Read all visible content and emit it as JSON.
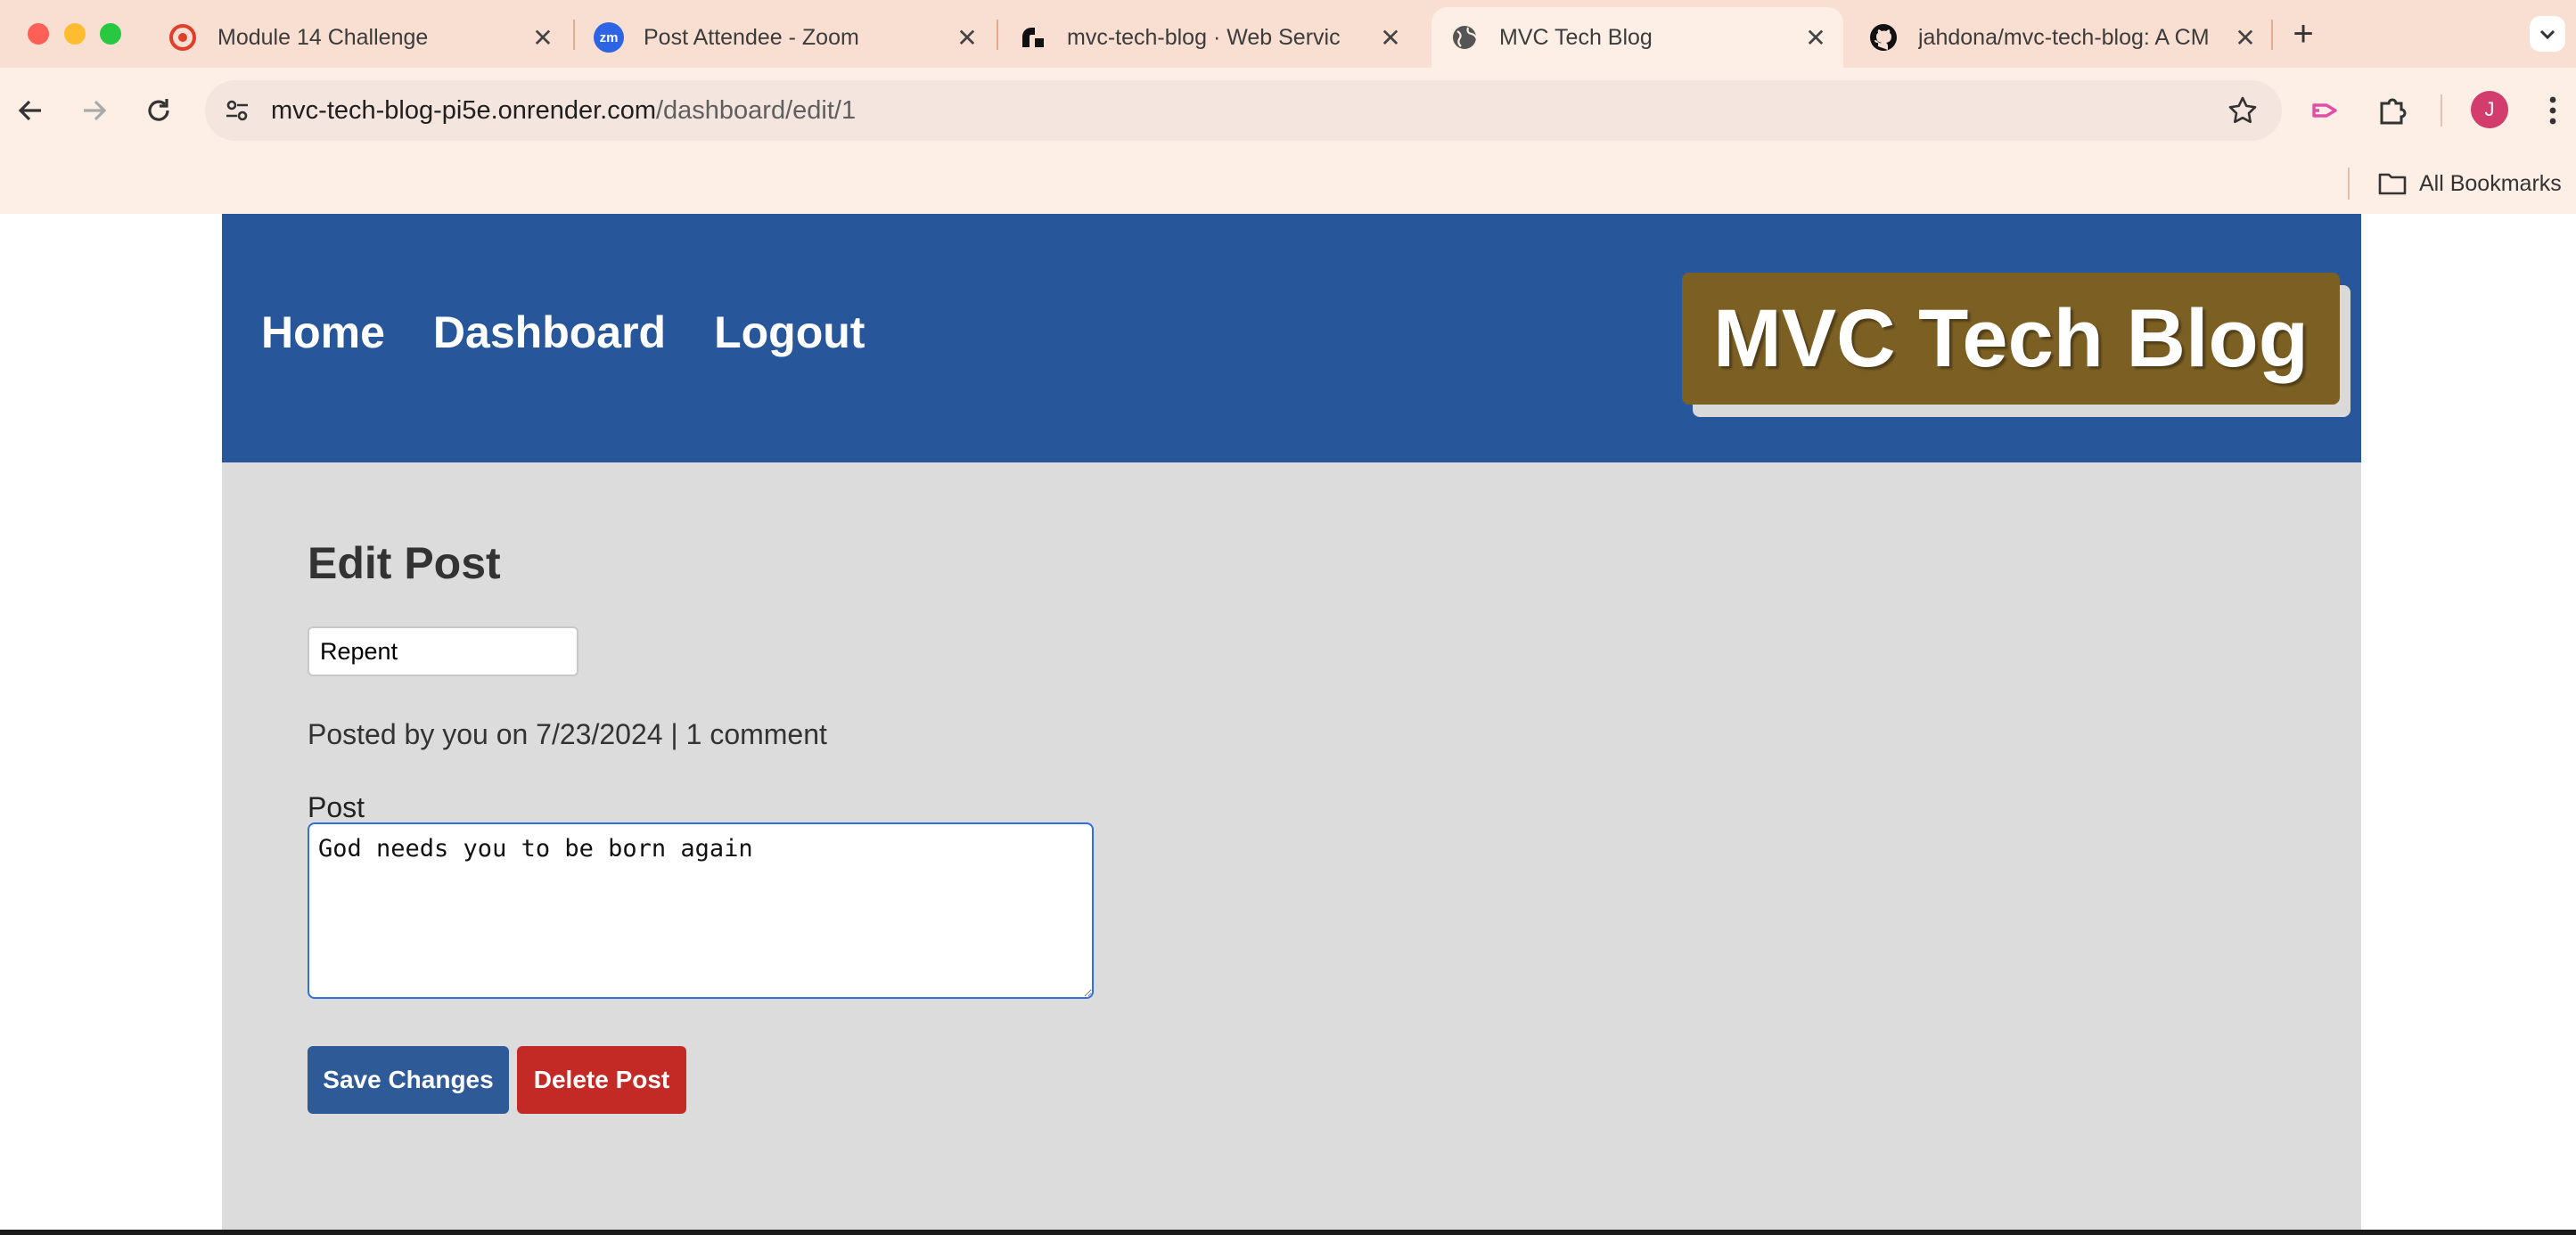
{
  "browser": {
    "tabs": [
      {
        "title": "Module 14 Challenge",
        "icon": "canvas-logo-icon",
        "active": false
      },
      {
        "title": "Post Attendee - Zoom",
        "icon": "zoom-icon",
        "active": false
      },
      {
        "title": "mvc-tech-blog · Web Servic",
        "icon": "render-icon",
        "active": false
      },
      {
        "title": "MVC Tech Blog",
        "icon": "globe-icon",
        "active": true
      },
      {
        "title": "jahdona/mvc-tech-blog: A CM",
        "icon": "github-icon",
        "active": false
      }
    ],
    "new_tab_label": "+",
    "zoom_favicon_text": "zm",
    "url_host": "mvc-tech-blog-pi5e.onrender.com",
    "url_path": "/dashboard/edit/1",
    "profile_initial": "J",
    "bookmarks_label": "All Bookmarks",
    "colors": {
      "tab_strip": "#f9dfd2",
      "toolbar": "#fdeee6",
      "omnibox": "#f4e6df"
    }
  },
  "site": {
    "nav": [
      {
        "label": "Home"
      },
      {
        "label": "Dashboard"
      },
      {
        "label": "Logout"
      }
    ],
    "brand": "MVC Tech Blog",
    "colors": {
      "header": "#27579a",
      "brand_bg": "#7b5f23",
      "page_bg": "#dcdcdc"
    }
  },
  "edit": {
    "heading": "Edit Post",
    "title_value": "Repent",
    "meta": "Posted by you on 7/23/2024 | 1 comment",
    "body_label": "Post",
    "body_value": "God needs you to be born again",
    "save_label": "Save Changes",
    "delete_label": "Delete Post",
    "colors": {
      "save": "#2e5a98",
      "delete": "#c42a25"
    }
  }
}
